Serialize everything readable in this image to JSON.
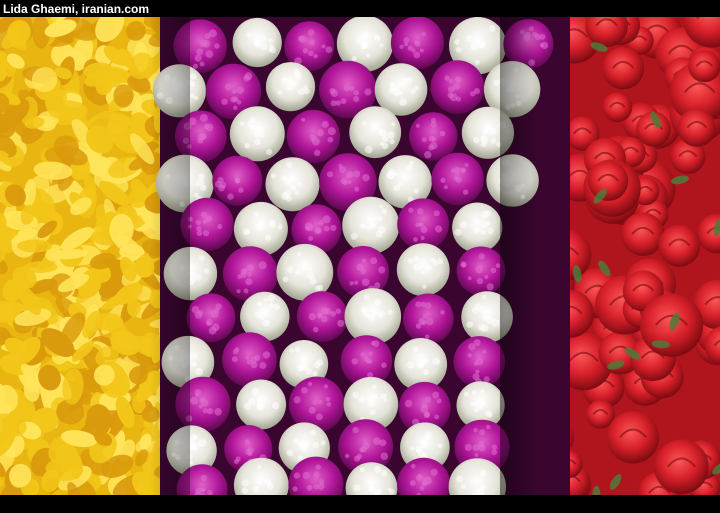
{
  "credit": {
    "text": "Lida Ghaemi, iranian.com"
  },
  "photo": {
    "subject_icons": [
      "marigold-garland-icon",
      "globe-amaranth-garland-icon",
      "red-rose-garland-icon"
    ],
    "colors": {
      "marigold": "#f2c619",
      "marigold_dark": "#d99a0c",
      "amaranth_purple": "#b2169a",
      "amaranth_white": "#e6e4da",
      "rose_red": "#d8202a",
      "rose_dark": "#8e0c14",
      "leaf_green": "#4f7a3a",
      "background": "#000000"
    }
  }
}
